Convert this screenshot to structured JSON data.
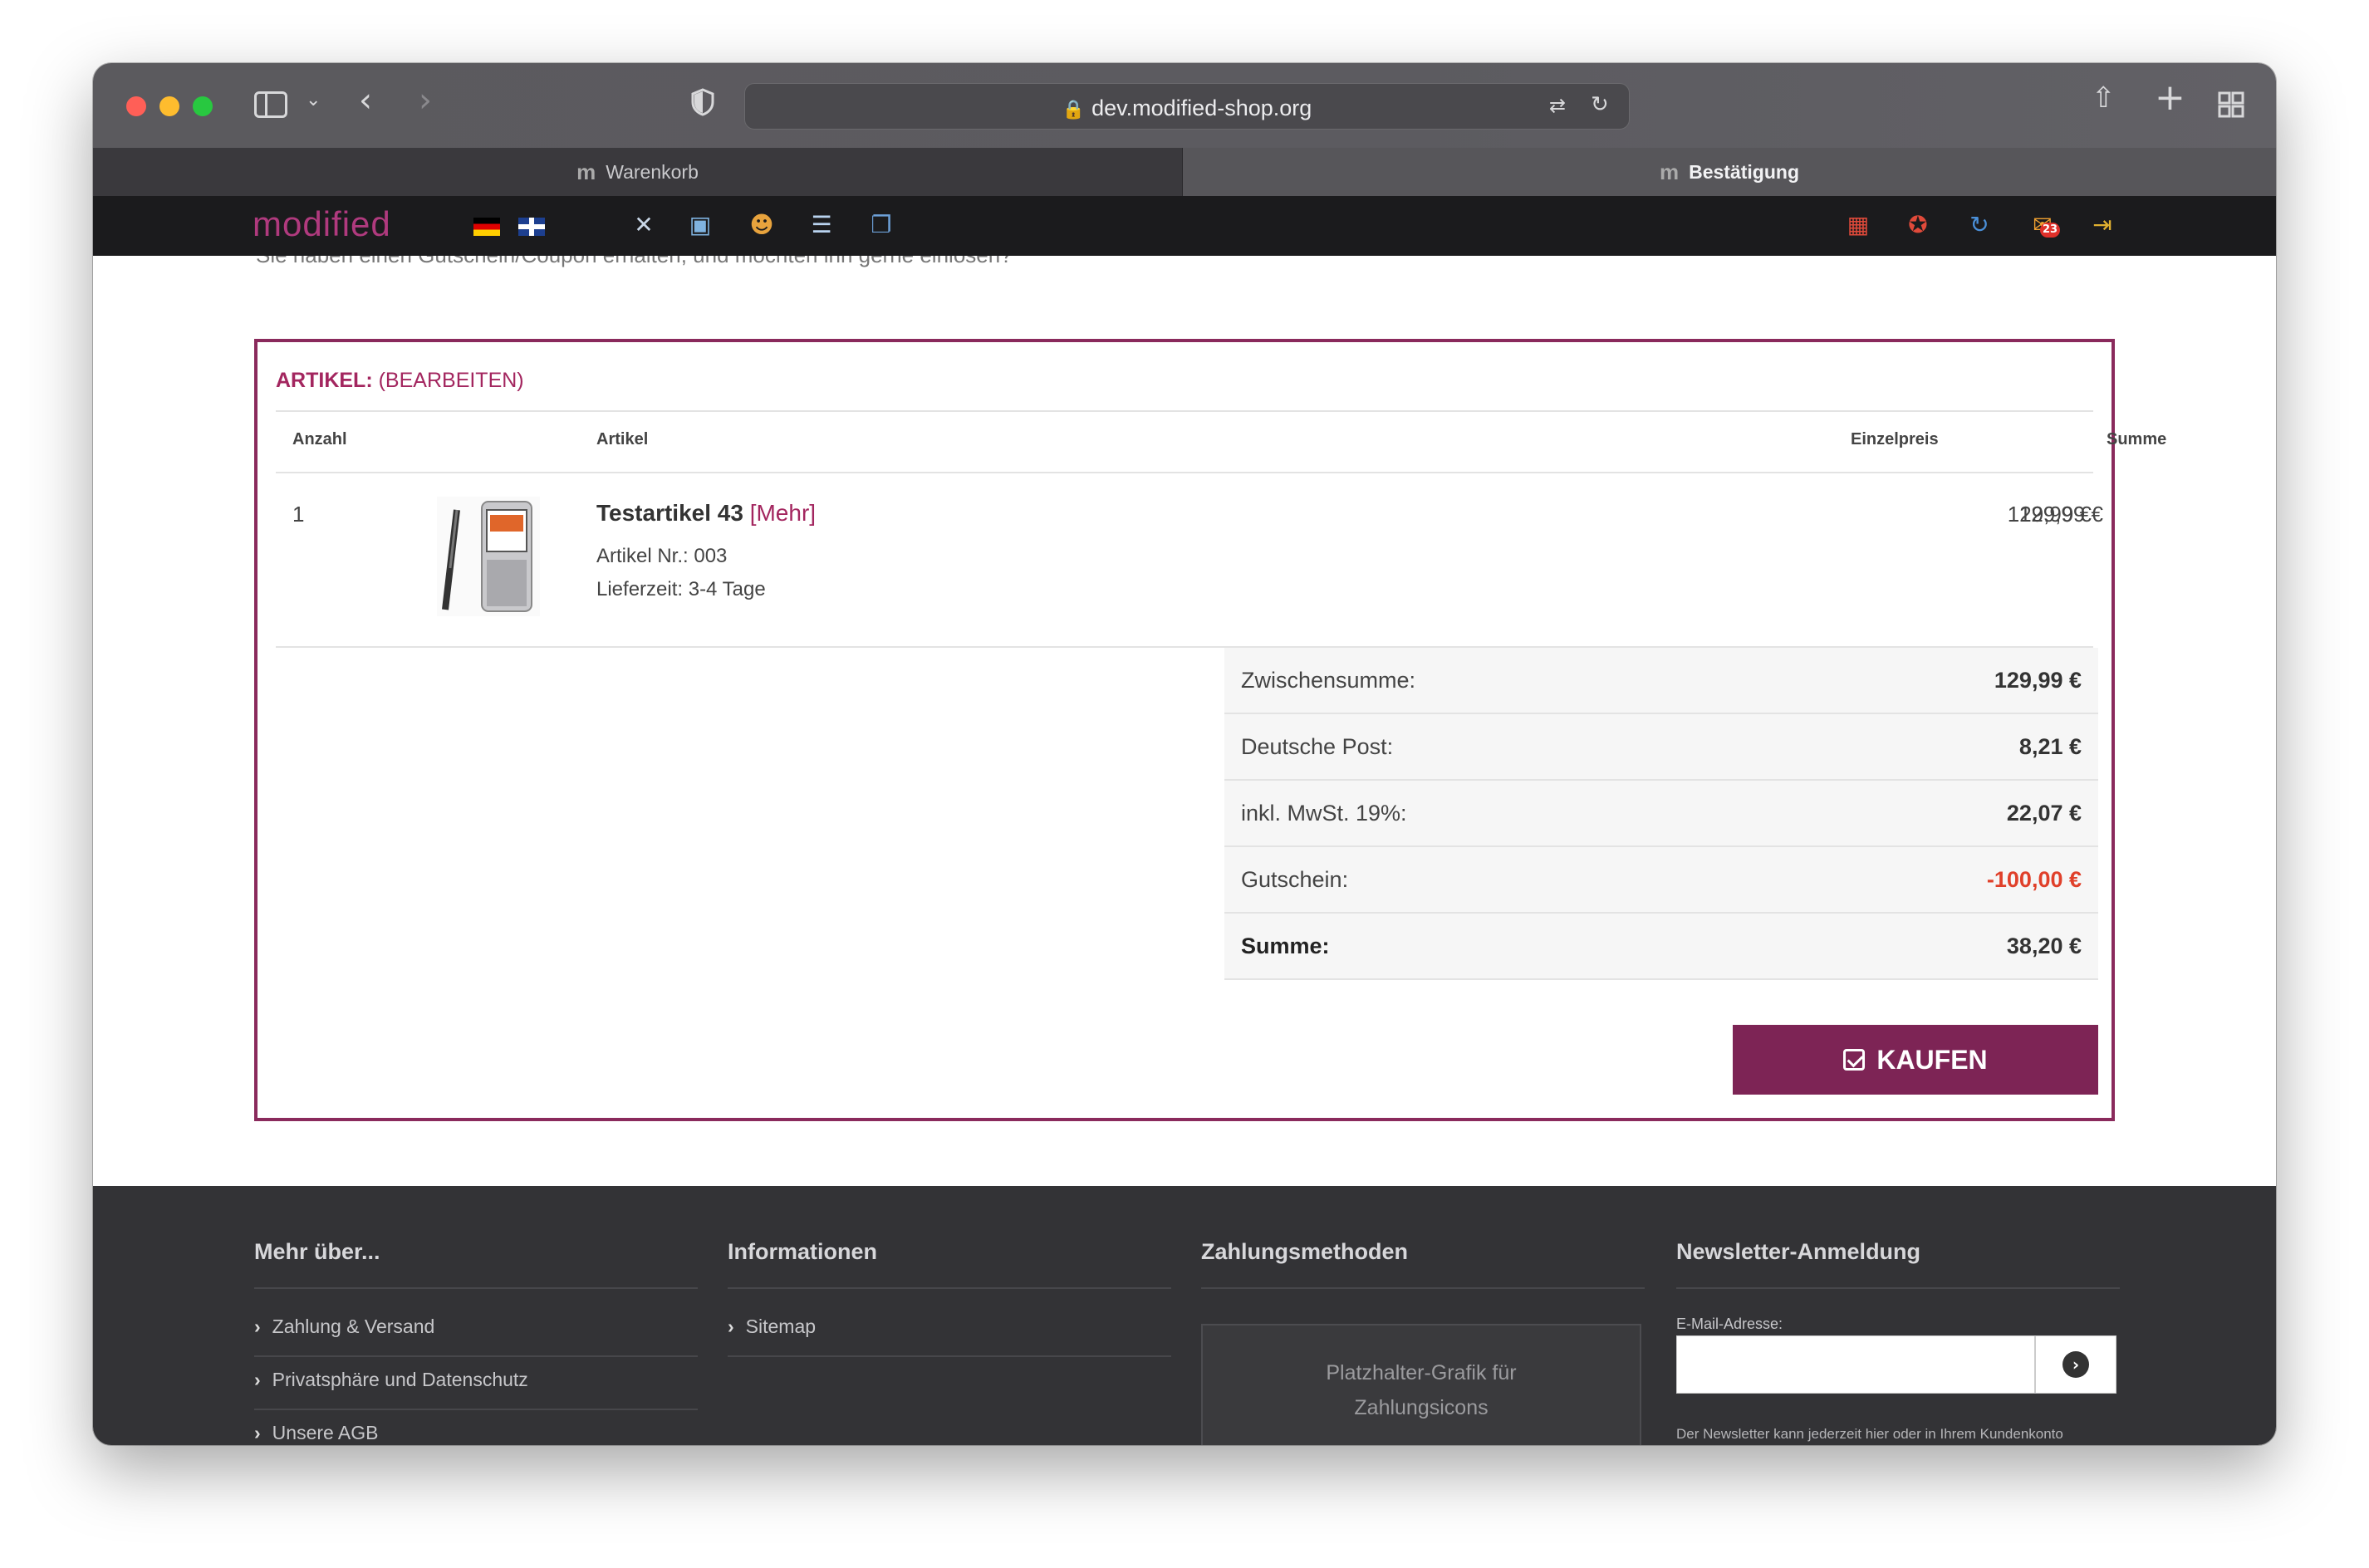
{
  "browser": {
    "url": "dev.modified-shop.org",
    "tabs": [
      {
        "label": "Warenkorb"
      },
      {
        "label": "Bestätigung"
      }
    ]
  },
  "adminbar": {
    "logo": "modified",
    "badge_count": "23"
  },
  "content": {
    "cut_text": "Sie haben einen Gutschein/Coupon erhalten, und möchten ihn gerne einlösen?",
    "cart": {
      "heading": "ARTIKEL:",
      "edit_link": "(BEARBEITEN)",
      "columns": {
        "qty": "Anzahl",
        "article": "Artikel",
        "unit_price": "Einzelpreis",
        "sum": "Summe"
      },
      "items": [
        {
          "qty": "1",
          "title": "Testartikel 43",
          "more": "[Mehr]",
          "article_no": "Artikel Nr.: 003",
          "delivery": "Lieferzeit: 3-4 Tage",
          "unit_price": "129,99 €",
          "sum": "129,99 €"
        }
      ],
      "totals": [
        {
          "label": "Zwischensumme:",
          "value": "129,99 €"
        },
        {
          "label": "Deutsche Post:",
          "value": "8,21 €"
        },
        {
          "label": "inkl. MwSt. 19%:",
          "value": "22,07 €"
        },
        {
          "label": "Gutschein:",
          "value": "-100,00 €"
        },
        {
          "label": "Summe:",
          "value": "38,20 €"
        }
      ],
      "buy_button": "KAUFEN"
    }
  },
  "footer": {
    "col1": {
      "heading": "Mehr über...",
      "links": [
        "Zahlung & Versand",
        "Privatsphäre und Datenschutz",
        "Unsere AGB"
      ]
    },
    "col2": {
      "heading": "Informationen",
      "links": [
        "Sitemap"
      ]
    },
    "col3": {
      "heading": "Zahlungsmethoden",
      "placeholder_line1": "Platzhalter-Grafik für",
      "placeholder_line2": "Zahlungsicons"
    },
    "col4": {
      "heading": "Newsletter-Anmeldung",
      "email_label": "E-Mail-Adresse:",
      "note": "Der Newsletter kann jederzeit hier oder in Ihrem Kundenkonto abbestellt werden."
    }
  },
  "colors": {
    "brand": "#7d2455",
    "accent": "#a3265f",
    "negative": "#e0402a"
  }
}
